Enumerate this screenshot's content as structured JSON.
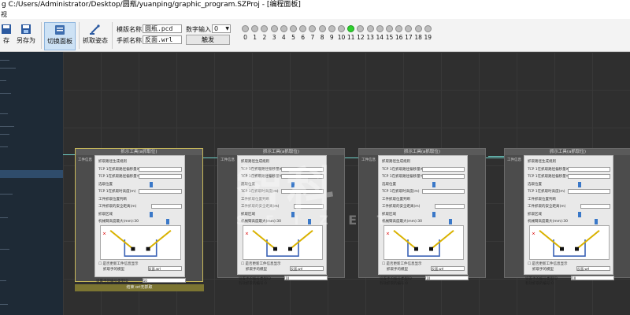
{
  "window": {
    "title": "g C:/Users/Administrator/Desktop/圆瓶/yuanping/graphic_program.SZProj - [编程面板]",
    "menu": "视"
  },
  "toolbar": {
    "save_label": "存",
    "save_as_label": "另存为",
    "switch_panel_label": "切换面板",
    "teach_pose_label": "抓取姿态"
  },
  "fields": {
    "model_label": "模版名称",
    "model_value": "圆瓶.pcd",
    "hand_label": "手抓名称",
    "hand_value": "反面.wrl",
    "digital_label": "数字输入：",
    "digital_value": "0",
    "trigger_label": "触发"
  },
  "indicators": {
    "numbers": [
      "0",
      "1",
      "2",
      "3",
      "4",
      "5",
      "6",
      "7",
      "8",
      "9",
      "10",
      "11",
      "12",
      "13",
      "14",
      "15",
      "16",
      "17",
      "18",
      "19"
    ],
    "active_index": 11
  },
  "nodes": [
    {
      "header": "抓示工具(a抓取位)",
      "input_label": "工件信息",
      "lines": [
        "抓取路径生成规则",
        "TCP 1在抓取路径偏移量X(m)",
        "TCP 1在抓取路径偏移量Y(m)",
        "选取位置",
        "TCP 1在抓取时高度(m)",
        "工件抓取位置判断",
        "工件抓取的安全距离(m)",
        "抓取区域",
        "机械臂高度最大(mm):30"
      ],
      "checkbox_label": "是否更新工件信息显示",
      "hand_label": "抓取手的模型",
      "hand_file": "反面.wrl",
      "id_label": "设置手的编号类型ID",
      "id_value": "10",
      "status": "有效抓取的编号:0",
      "footer": "结束 ori无抓取"
    },
    {
      "header": "抓示工具(a抓取位)",
      "input_label": "工件信息",
      "lines": [
        "抓取路径生成规则",
        "TCP 1在抓取路径偏移量X(m)",
        "TCP 1在抓取路径偏移量Y(m)",
        "选取位置",
        "TCP 1在抓取时高度(m)",
        "工件抓取位置判断",
        "工件抓取的安全距离(m)",
        "抓取区域",
        "机械臂高度最大(mm):30"
      ],
      "checkbox_label": "是否更新工件信息显示",
      "hand_label": "抓取手的模型",
      "hand_file": "反面.wrl",
      "id_label": "设置手的编号类型ID",
      "id_value": "10",
      "status": "有效抓取的编号:0"
    },
    {
      "header": "抓示工具(a抓取位)",
      "input_label": "工件信息",
      "lines": [
        "抓取路径生成规则",
        "TCP 1在抓取路径偏移量X(m)",
        "TCP 1在抓取路径偏移量Y(m)",
        "选取位置",
        "TCP 1在抓取时高度(m)",
        "工件抓取位置判断",
        "工件抓取的安全距离(m)",
        "抓取区域",
        "机械臂高度最大(mm):30"
      ],
      "checkbox_label": "是否更新工件信息显示",
      "hand_label": "抓取手的模型",
      "hand_file": "反面.wrl",
      "id_label": "设置手的编号类型ID",
      "id_value": "10",
      "status": "有效抓取的编号:0"
    },
    {
      "header": "抓示工具(a抓取位)",
      "input_label": "工件信息",
      "lines": [
        "抓取路径生成规则",
        "TCP 1在抓取路径偏移量X(m)",
        "TCP 1在抓取路径偏移量Y(m)",
        "选取位置",
        "TCP 1在抓取时高度(m)",
        "工件抓取位置判断",
        "工件抓取的安全距离(m)",
        "抓取区域",
        "机械臂高度最大(mm):30"
      ],
      "checkbox_label": "是否更新工件信息显示",
      "hand_label": "抓取手的模型",
      "hand_file": "反面.wrl",
      "id_label": "设置手的编号类型ID",
      "id_value": "10",
      "status": "有效抓取的编号:0"
    }
  ],
  "watermark": {
    "brand": "智科",
    "letters": "S E I Z E T"
  },
  "colors": {
    "canvas": "#2f2f2f",
    "sidebar": "#1e2a36",
    "active_dot": "#2fd12f",
    "wire": "#6fd0c8",
    "selected_footer": "#7c7532"
  }
}
